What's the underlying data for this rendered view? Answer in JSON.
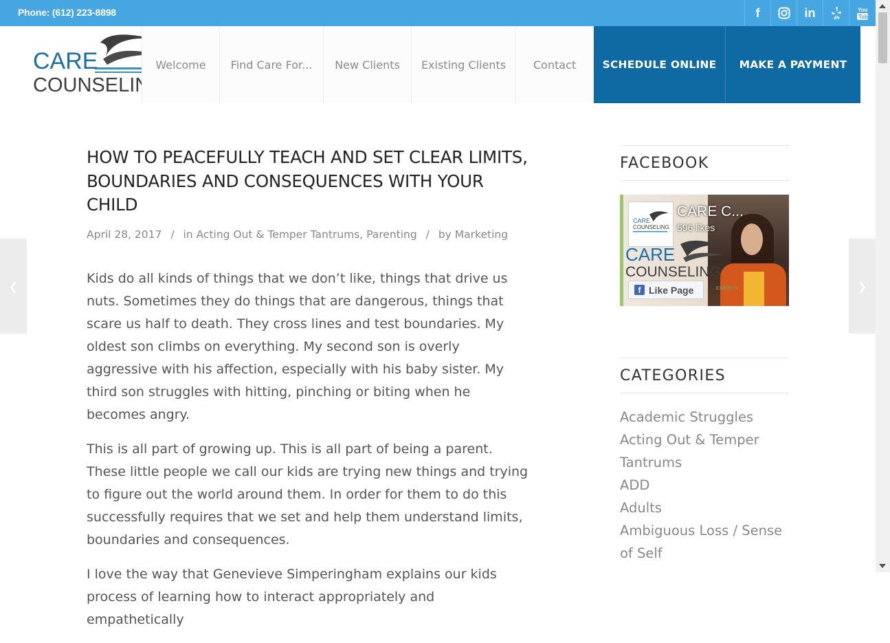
{
  "topbar": {
    "phone": "Phone: (612) 223-8898",
    "social": [
      "facebook-icon",
      "instagram-icon",
      "linkedin-icon",
      "yelp-icon",
      "youtube-icon"
    ],
    "color": "#45a6e2"
  },
  "logo": {
    "line1": "CARE",
    "line2": "COUNSELING"
  },
  "nav": {
    "items": [
      "Welcome",
      "Find Care For...",
      "New Clients",
      "Existing Clients",
      "Contact"
    ],
    "cta": [
      "SCHEDULE ONLINE",
      "MAKE A PAYMENT"
    ],
    "cta_color": "#0f6aa3"
  },
  "article": {
    "title": "HOW TO PEACEFULLY TEACH AND SET CLEAR LIMITS, BOUNDARIES AND CONSEQUENCES WITH YOUR CHILD",
    "date": "April 28, 2017",
    "in_label": "in",
    "categories": [
      "Acting Out & Temper Tantrums",
      "Parenting"
    ],
    "by_label": "by",
    "author": "Marketing",
    "paragraphs": [
      "Kids do all kinds of things that we don’t like, things that drive us nuts. Sometimes they do things that are dangerous, things that scare us half to death. They cross lines and test boundaries. My oldest son climbs on everything. My second son is overly aggressive with his affection, especially with his baby sister. My third son struggles with hitting, pinching or biting when he becomes angry.",
      "This is all part of growing up. This is all part of being a parent. These little people we call our kids are trying new things and trying to figure out the world around them. In order for them to do this successfully requires that we set and help them understand limits, boundaries and consequences.",
      "I love the way that Genevieve Simperingham explains our kids process of learning how to interact appropriately and empathetically"
    ]
  },
  "sidebar": {
    "facebook_title": "FACEBOOK",
    "fb_page_name": "CARE C...",
    "fb_likes": "596 likes",
    "fb_like_button": "Like Page",
    "fb_experts": "EXPERTS",
    "categories_title": "CATEGORIES",
    "categories": [
      "Academic Struggles",
      "Acting Out & Temper Tantrums",
      "ADD",
      "Adults",
      "Ambiguous Loss / Sense of Self"
    ]
  }
}
